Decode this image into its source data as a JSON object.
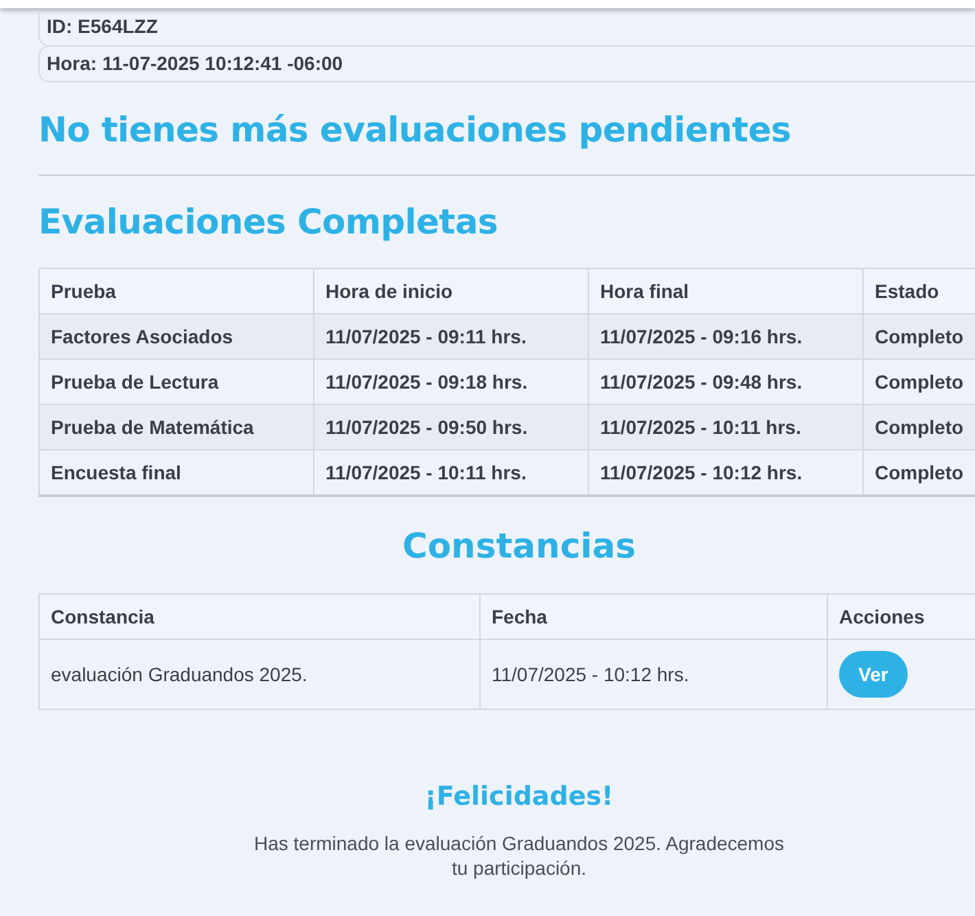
{
  "info": [
    {
      "text": "ID: E564LZZ"
    },
    {
      "text": "Hora: 11-07-2025 10:12:41 -06:00"
    }
  ],
  "pending_title": "No tienes más evaluaciones pendientes",
  "completed": {
    "title": "Evaluaciones Completas",
    "columns": [
      "Prueba",
      "Hora de inicio",
      "Hora final",
      "Estado"
    ],
    "rows": [
      [
        "Factores Asociados",
        "11/07/2025 - 09:11 hrs.",
        "11/07/2025 - 09:16 hrs.",
        "Completo"
      ],
      [
        "Prueba de Lectura",
        "11/07/2025 - 09:18 hrs.",
        "11/07/2025 - 09:48 hrs.",
        "Completo"
      ],
      [
        "Prueba de Matemática",
        "11/07/2025 - 09:50 hrs.",
        "11/07/2025 - 10:11 hrs.",
        "Completo"
      ],
      [
        "Encuesta final",
        "11/07/2025 - 10:11 hrs.",
        "11/07/2025 - 10:12 hrs.",
        "Completo"
      ]
    ]
  },
  "certificates": {
    "title": "Constancias",
    "columns": [
      "Constancia",
      "Fecha",
      "Acciones"
    ],
    "rows": [
      {
        "name": "evaluación Graduandos 2025.",
        "date": "11/07/2025 - 10:12 hrs.",
        "action": "Ver"
      }
    ]
  },
  "congrats": {
    "title": "¡Felicidades!",
    "message": "Has terminado la evaluación Graduandos 2025. Agradecemos tu participación."
  }
}
